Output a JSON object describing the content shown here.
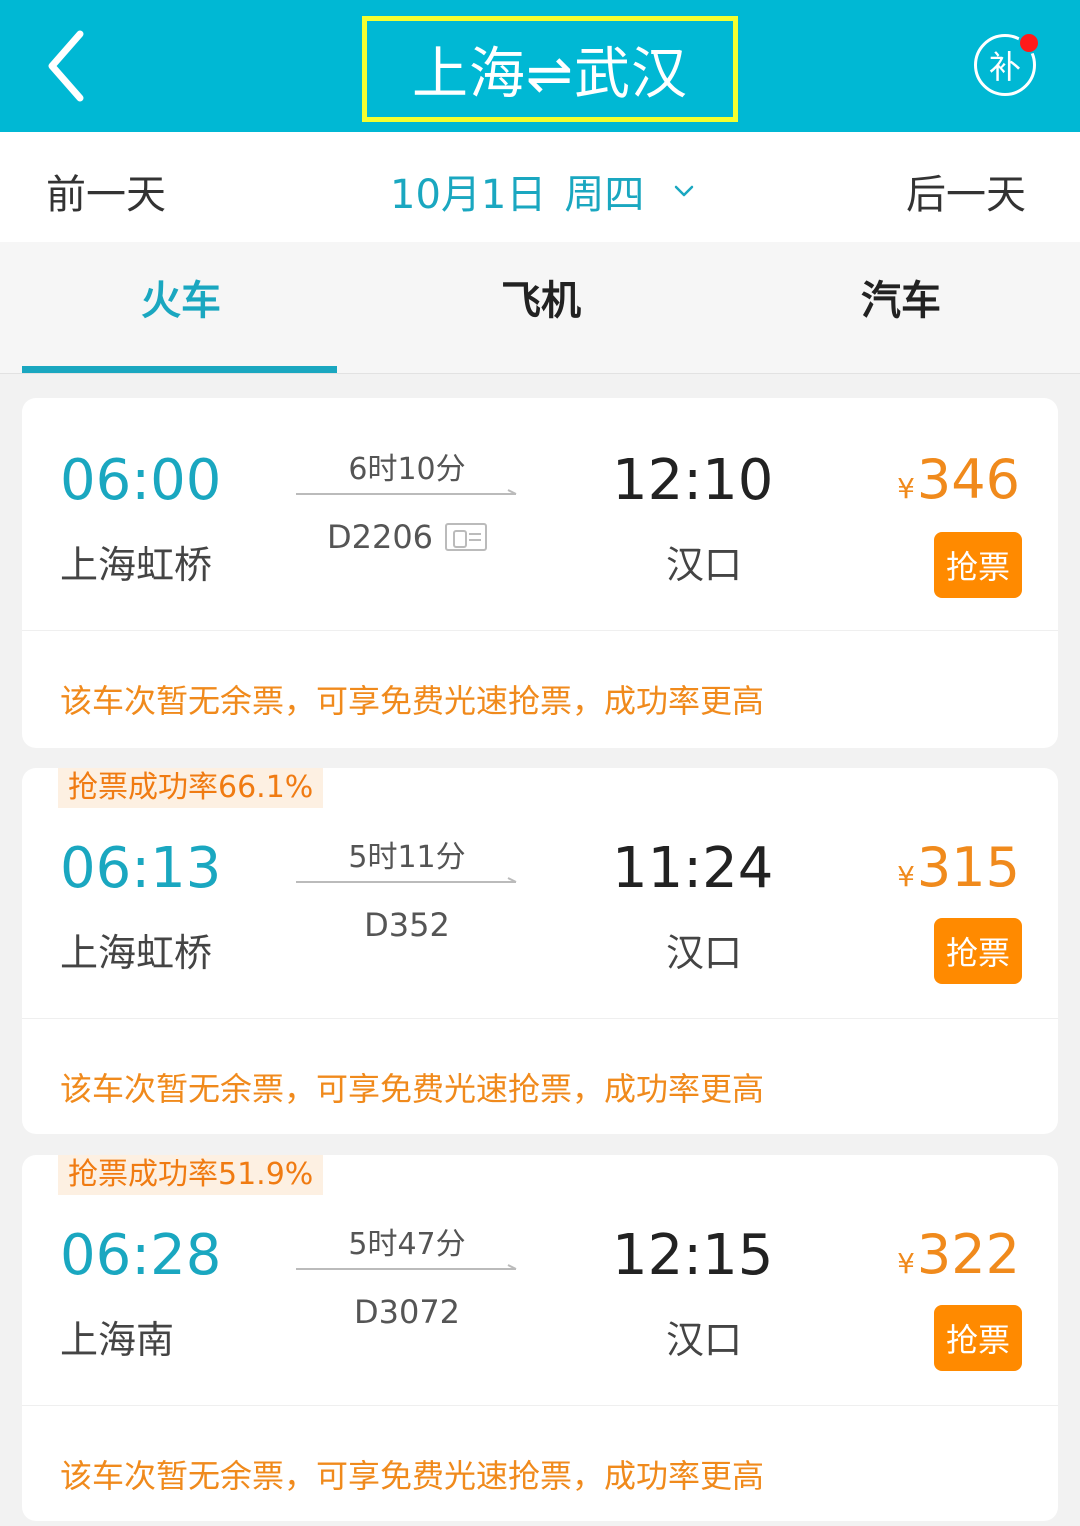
{
  "header": {
    "title": "上海⇌武汉",
    "supp_label": "补"
  },
  "datebar": {
    "prev": "前一天",
    "date": "10月1日",
    "weekday": "周四",
    "next": "后一天"
  },
  "tabs": [
    "火车",
    "飞机",
    "汽车"
  ],
  "trains": [
    {
      "badge": "",
      "dep_time": "06:00",
      "dep_station": "上海虹桥",
      "duration": "6时10分",
      "train_no": "D2206",
      "arr_time": "12:10",
      "arr_station": "汉口",
      "yen": "¥",
      "price": "346",
      "button": "抢票",
      "notice": "该车次暂无余票，可享免费光速抢票，成功率更高"
    },
    {
      "badge": "抢票成功率66.1%",
      "dep_time": "06:13",
      "dep_station": "上海虹桥",
      "duration": "5时11分",
      "train_no": "D352",
      "arr_time": "11:24",
      "arr_station": "汉口",
      "yen": "¥",
      "price": "315",
      "button": "抢票",
      "notice": "该车次暂无余票，可享免费光速抢票，成功率更高"
    },
    {
      "badge": "抢票成功率51.9%",
      "dep_time": "06:28",
      "dep_station": "上海南",
      "duration": "5时47分",
      "train_no": "D3072",
      "arr_time": "12:15",
      "arr_station": "汉口",
      "yen": "¥",
      "price": "322",
      "button": "抢票",
      "notice": "该车次暂无余票，可享免费光速抢票，成功率更高"
    }
  ],
  "icons": {
    "back": "back-chevron-icon",
    "supp": "supplement-icon",
    "date_dropdown": "chevron-down-icon",
    "id_card": "id-card-icon"
  },
  "colors": {
    "header_bg": "#00b8d4",
    "accent": "#1aa7c0",
    "price": "#f08a1c",
    "button": "#ff8a00",
    "highlight_box": "#f4ff2f"
  }
}
